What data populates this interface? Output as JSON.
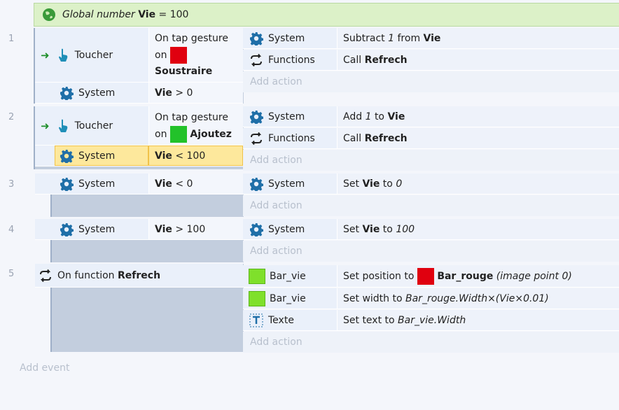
{
  "global": {
    "prefix": "Global number",
    "name": "Vie",
    "eq": "= 100"
  },
  "events": [
    {
      "number": "1",
      "conditions": [
        {
          "object": "Toucher",
          "text_a": "On tap gesture",
          "text_b": "on",
          "text_c": "Soustraire"
        },
        {
          "object": "System",
          "var": "Vie",
          "op": "> 0"
        }
      ],
      "actions": [
        {
          "object": "System",
          "pre": "Subtract",
          "num": "1",
          "mid": "from",
          "var": "Vie"
        },
        {
          "object": "Functions",
          "pre": "Call",
          "var": "Refrech"
        }
      ],
      "add_action": "Add action"
    },
    {
      "number": "2",
      "conditions": [
        {
          "object": "Toucher",
          "text_a": "On tap gesture",
          "text_b": "on",
          "text_c": "Ajoutez"
        },
        {
          "object": "System",
          "var": "Vie",
          "op": "< 100"
        }
      ],
      "actions": [
        {
          "object": "System",
          "pre": "Add",
          "num": "1",
          "mid": "to",
          "var": "Vie"
        },
        {
          "object": "Functions",
          "pre": "Call",
          "var": "Refrech"
        }
      ],
      "add_action": "Add action"
    },
    {
      "number": "3",
      "conditions": [
        {
          "object": "System",
          "var": "Vie",
          "op": "< 0"
        }
      ],
      "actions": [
        {
          "object": "System",
          "pre": "Set",
          "var": "Vie",
          "mid": "to",
          "num": "0"
        }
      ],
      "add_action": "Add action"
    },
    {
      "number": "4",
      "conditions": [
        {
          "object": "System",
          "var": "Vie",
          "op": "> 100"
        }
      ],
      "actions": [
        {
          "object": "System",
          "pre": "Set",
          "var": "Vie",
          "mid": "to",
          "num": "100"
        }
      ],
      "add_action": "Add action"
    },
    {
      "number": "5",
      "conditions": [
        {
          "pre": "On function",
          "name": "Refrech"
        }
      ],
      "actions": [
        {
          "object": "Bar_vie",
          "pre": "Set position to",
          "target": "Bar_rouge",
          "tail": "(image point 0)"
        },
        {
          "object": "Bar_vie",
          "pre": "Set width to",
          "expr": "Bar_rouge.Width×(Vie×0.01)"
        },
        {
          "object": "Texte",
          "pre": "Set text to",
          "expr": "Bar_vie.Width"
        }
      ],
      "add_action": "Add action"
    }
  ],
  "add_event": "Add event",
  "icons": {
    "globe": "globe-icon",
    "gear": "gear-icon",
    "touch": "touch-icon",
    "functions": "functions-icon",
    "sprite": "sprite-icon",
    "text": "text-icon"
  },
  "colors": {
    "red_swatch": "#e0000f",
    "green_swatch": "#22c22a",
    "lime_sprite": "#7fe02b",
    "global_bg": "#dcf1c8",
    "selected_bg": "#fde89c"
  }
}
